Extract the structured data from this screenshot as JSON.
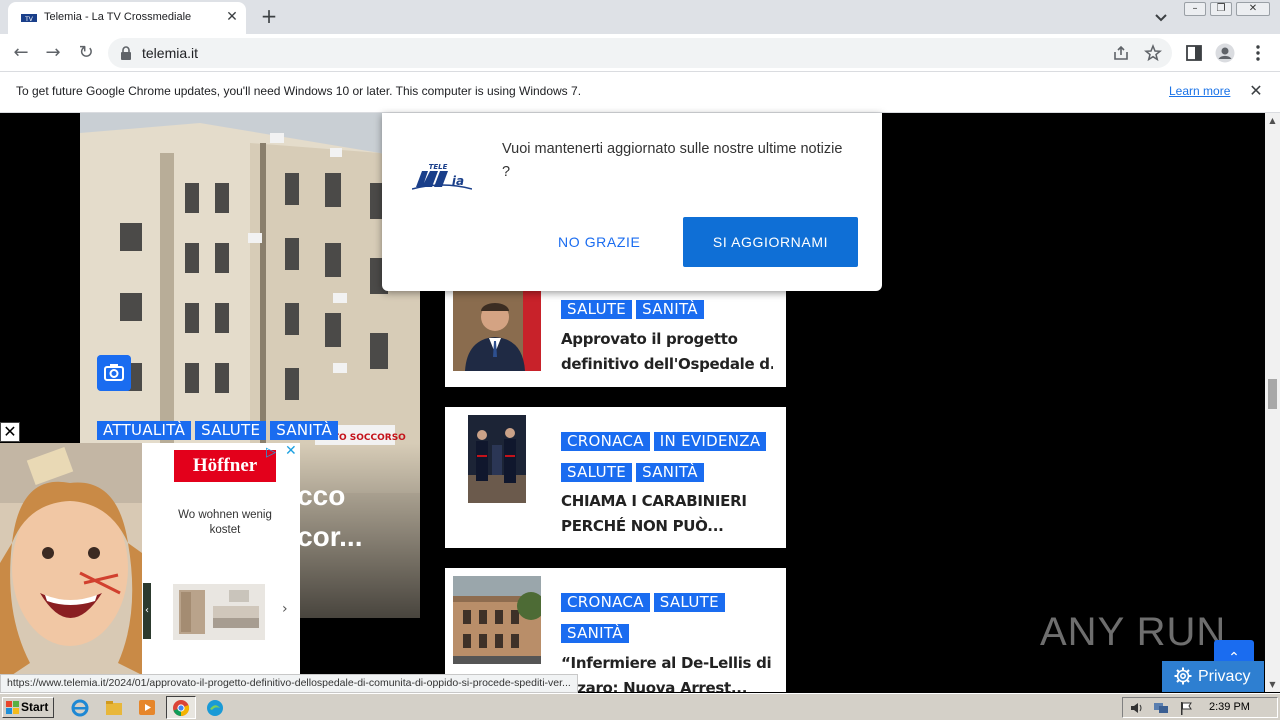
{
  "browser": {
    "tab_title": "Telemia - La TV Crossmediale",
    "url": "telemia.it",
    "infobar_message": "To get future Google Chrome updates, you'll need Windows 10 or later. This computer is using Windows 7.",
    "infobar_link": "Learn more",
    "status_url": "https://www.telemia.it/2024/01/approvato-il-progetto-definitivo-dellospedale-di-comunita-di-oppido-si-procede-spediti-ver..."
  },
  "hero": {
    "tags": [
      "ATTUALITÀ",
      "SALUTE",
      "SANITÀ"
    ],
    "title_line1": "occo",
    "title_line2": "ncor..."
  },
  "popup": {
    "message": "Vuoi mantenerti aggiornato sulle nostre ultime notizie ?",
    "decline_label": "NO GRAZIE",
    "accept_label": "SI AGGIORNAMI",
    "logo_text": "TELE MIA"
  },
  "articles": [
    {
      "tags": [
        "SALUTE",
        "SANITÀ"
      ],
      "title_line1": "Approvato il progetto",
      "title_line2": "definitivo dell'Ospedale d..."
    },
    {
      "tags": [
        "CRONACA",
        "IN EVIDENZA",
        "SALUTE",
        "SANITÀ"
      ],
      "title_line1": "CHIAMA I CARABINIERI",
      "title_line2": "PERCHÉ NON PUÒ..."
    },
    {
      "tags": [
        "CRONACA",
        "SALUTE",
        "SANITÀ"
      ],
      "title_line1": "“Infermiere al De-Lellis di",
      "title_line2": "...zaro: Nuova Arrest..."
    }
  ],
  "ad": {
    "brand": "Höffner",
    "copy": "Wo wohnen wenig kostet",
    "prev": "‹",
    "next": "›"
  },
  "watermark": "ANY RUN",
  "privacy_label": "Privacy",
  "taskbar": {
    "start_label": "Start",
    "clock": "2:39 PM"
  },
  "colors": {
    "tag_blue": "#1a6cf0",
    "popup_button": "#0f6fd6",
    "chrome_tabstrip": "#dee1e6"
  }
}
